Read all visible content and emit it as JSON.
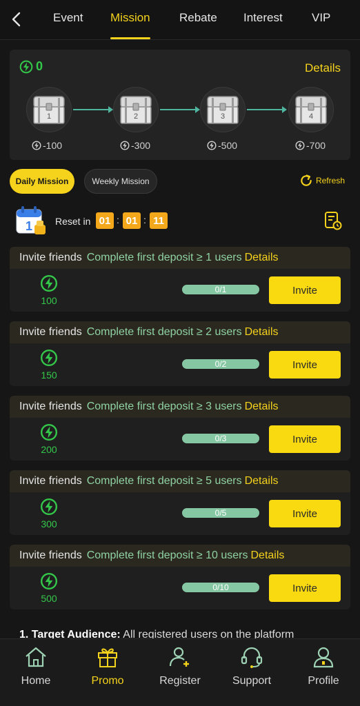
{
  "tabs": [
    {
      "label": "Event",
      "active": false
    },
    {
      "label": "Mission",
      "active": true
    },
    {
      "label": "Rebate",
      "active": false
    },
    {
      "label": "Interest",
      "active": false
    },
    {
      "label": "VIP",
      "active": false
    }
  ],
  "rewards_panel": {
    "total": "0",
    "details_label": "Details",
    "chests": [
      {
        "number": "1",
        "cost": "-100"
      },
      {
        "number": "2",
        "cost": "-300"
      },
      {
        "number": "3",
        "cost": "-500"
      },
      {
        "number": "4",
        "cost": "-700"
      }
    ]
  },
  "mission_type": {
    "daily_label": "Daily Mission",
    "weekly_label": "Weekly Mission",
    "selected": "daily",
    "refresh_label": "Refresh"
  },
  "reset": {
    "label": "Reset in",
    "hours": "01",
    "minutes": "01",
    "seconds": "11"
  },
  "missions": [
    {
      "type": "Invite friends",
      "description": "Complete first deposit ≥ 1 users",
      "details": "Details",
      "reward": "100",
      "progress": "0/1",
      "button": "Invite"
    },
    {
      "type": "Invite friends",
      "description": "Complete first deposit ≥ 2 users",
      "details": "Details",
      "reward": "150",
      "progress": "0/2",
      "button": "Invite"
    },
    {
      "type": "Invite friends",
      "description": "Complete first deposit ≥ 3 users",
      "details": "Details",
      "reward": "200",
      "progress": "0/3",
      "button": "Invite"
    },
    {
      "type": "Invite friends",
      "description": "Complete first deposit ≥ 5 users",
      "details": "Details",
      "reward": "300",
      "progress": "0/5",
      "button": "Invite"
    },
    {
      "type": "Invite friends",
      "description": "Complete first deposit ≥ 10 users",
      "details": "Details",
      "reward": "500",
      "progress": "0/10",
      "button": "Invite"
    }
  ],
  "rules_preview": {
    "heading": "1. Target Audience:",
    "text": " All registered users on the platform"
  },
  "bottom_nav": [
    {
      "label": "Home",
      "icon": "home-icon",
      "active": false
    },
    {
      "label": "Promo",
      "icon": "gift-icon",
      "active": true
    },
    {
      "label": "Register",
      "icon": "add-user-icon",
      "active": false
    },
    {
      "label": "Support",
      "icon": "headset-icon",
      "active": false
    },
    {
      "label": "Profile",
      "icon": "profile-icon",
      "active": false
    }
  ],
  "colors": {
    "accent": "#f5d31c",
    "coin_green": "#34c84a",
    "progress_track": "#86c7a3",
    "timer_orange": "#f2a81a",
    "background": "#161616"
  }
}
